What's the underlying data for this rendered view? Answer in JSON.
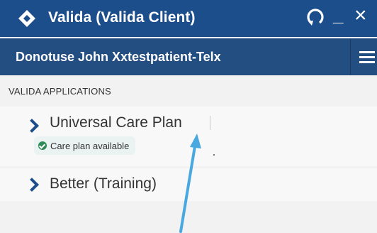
{
  "window": {
    "title": "Valida (Valida Client)",
    "minimize_label": "_",
    "close_label": "×"
  },
  "patient": {
    "name": "Donotuse John Xxtestpatient-Telx"
  },
  "section": {
    "label": "VALIDA APPLICATIONS"
  },
  "applications": [
    {
      "label": "Universal Care Plan",
      "status": "Care plan available"
    },
    {
      "label": "Better (Training)"
    }
  ],
  "colors": {
    "titlebar": "#1c4e8c",
    "patientbar": "#234e82",
    "accent": "#1c4e8c",
    "status_ok": "#2e8b57",
    "annotation_arrow": "#4aa8e0"
  },
  "icons": [
    "valida-logo-icon",
    "refresh-icon",
    "hamburger-menu-icon",
    "chevron-right-icon",
    "check-circle-icon"
  ]
}
